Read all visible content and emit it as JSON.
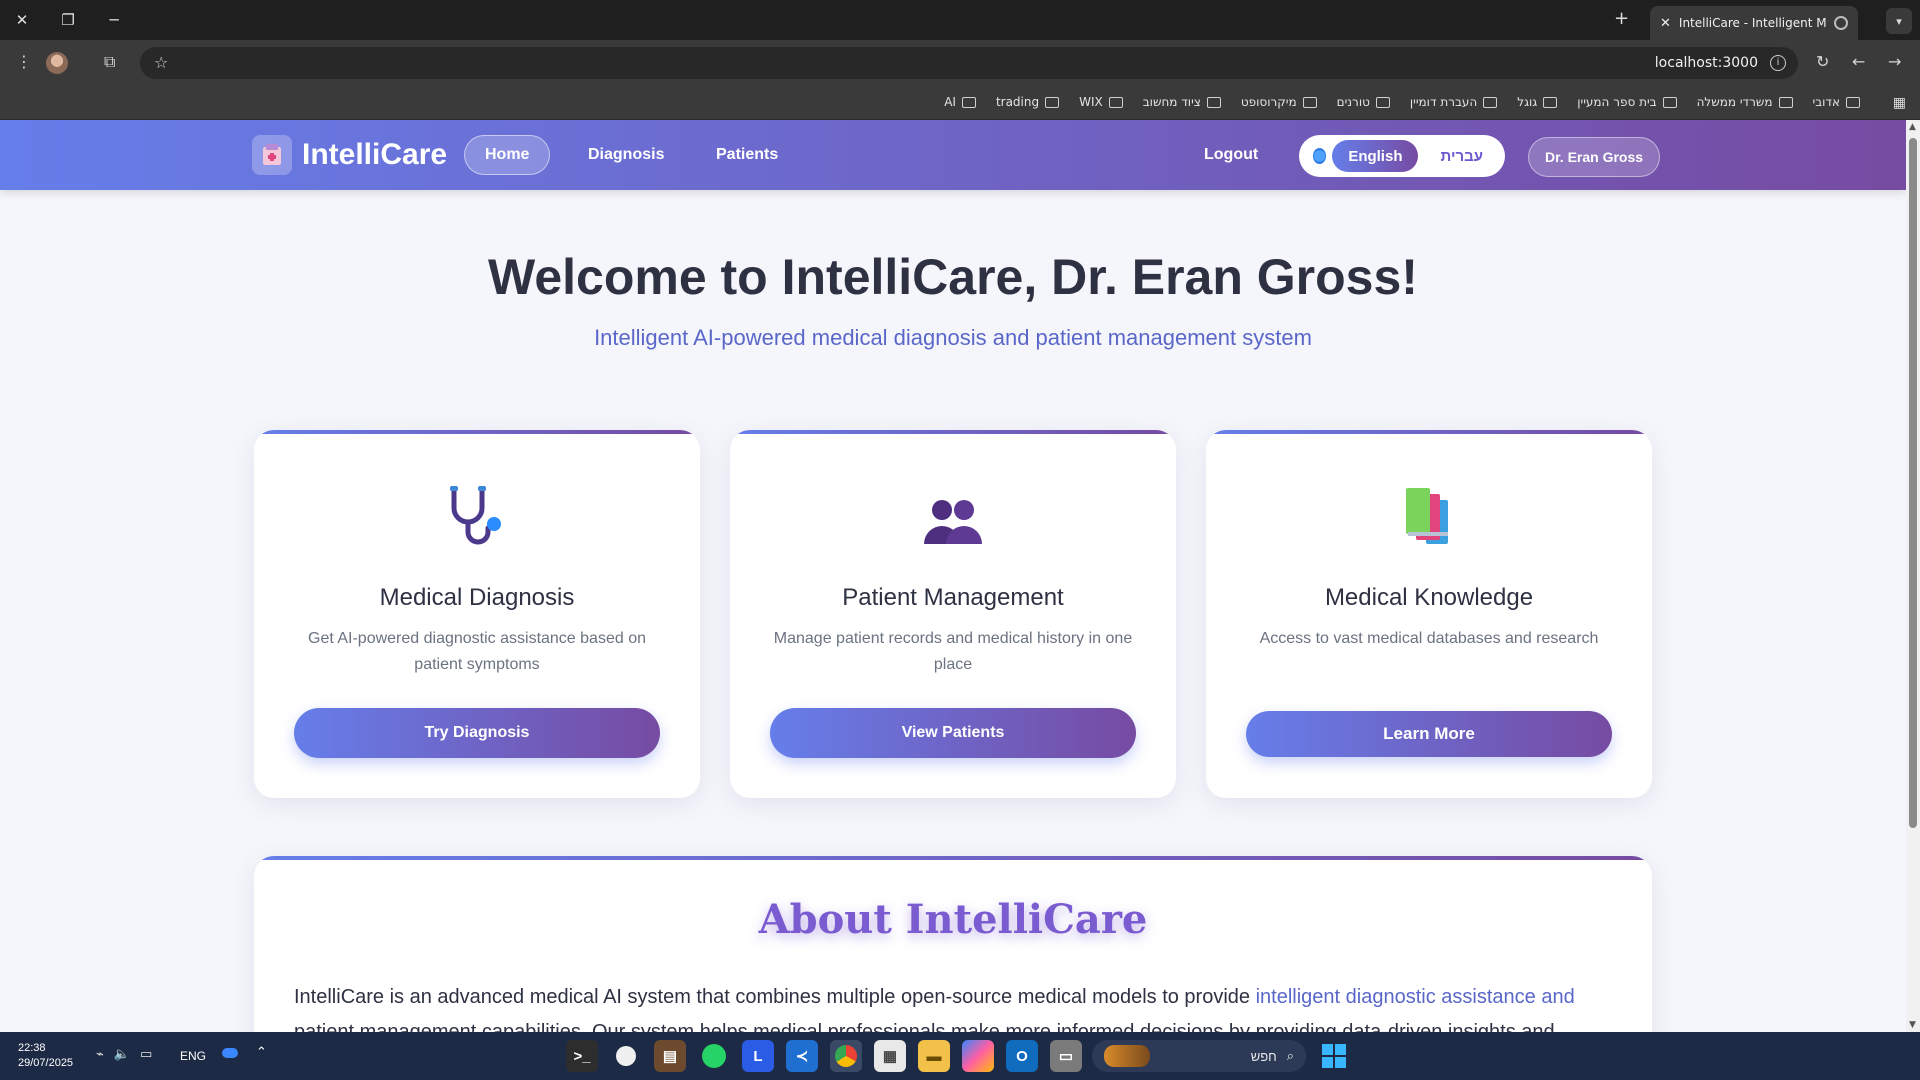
{
  "browser": {
    "tab_title": "IntelliCare - Intelligent Medical",
    "url": "localhost:3000",
    "bookmarks": [
      "אדובי",
      "משרדי ממשלה",
      "בית ספר המעיין",
      "גוגל",
      "העברת דומיין",
      "טורנים",
      "מיקרוסופט",
      "ציוד מחשוב",
      "WIX",
      "trading",
      "AI"
    ]
  },
  "header": {
    "brand": "IntelliCare",
    "nav": {
      "home": "Home",
      "diagnosis": "Diagnosis",
      "patients": "Patients"
    },
    "logout": "Logout",
    "lang": {
      "english": "English",
      "hebrew": "עברית"
    },
    "user": "Dr. Eran Gross"
  },
  "hero": {
    "welcome": "Welcome to IntelliCare, Dr. Eran Gross!",
    "subtitle": "Intelligent AI-powered medical diagnosis and patient management system"
  },
  "cards": [
    {
      "icon": "stethoscope-icon",
      "title": "Medical Diagnosis",
      "desc": "Get AI-powered diagnostic assistance based on patient symptoms",
      "button": "Try Diagnosis"
    },
    {
      "icon": "people-icon",
      "title": "Patient Management",
      "desc": "Manage patient records and medical history in one place",
      "button": "View Patients"
    },
    {
      "icon": "books-icon",
      "title": "Medical Knowledge",
      "desc": "Access to vast medical databases and research",
      "button": "Learn More"
    }
  ],
  "about": {
    "title": "About IntelliCare",
    "text_a": "IntelliCare is an advanced medical AI system that combines multiple open-source medical models to provide ",
    "text_hl": "intelligent diagnostic assistance and",
    "text_b": "patient management capabilities. Our system helps medical professionals make more informed decisions by providing data-driven insights and"
  },
  "taskbar": {
    "time": "22:38",
    "date": "29/07/2025",
    "lang": "ENG",
    "search_placeholder": "חפש"
  },
  "colors": {
    "header_start": "#667eea",
    "header_end": "#764ba2",
    "accent_text": "#5a67c9"
  }
}
